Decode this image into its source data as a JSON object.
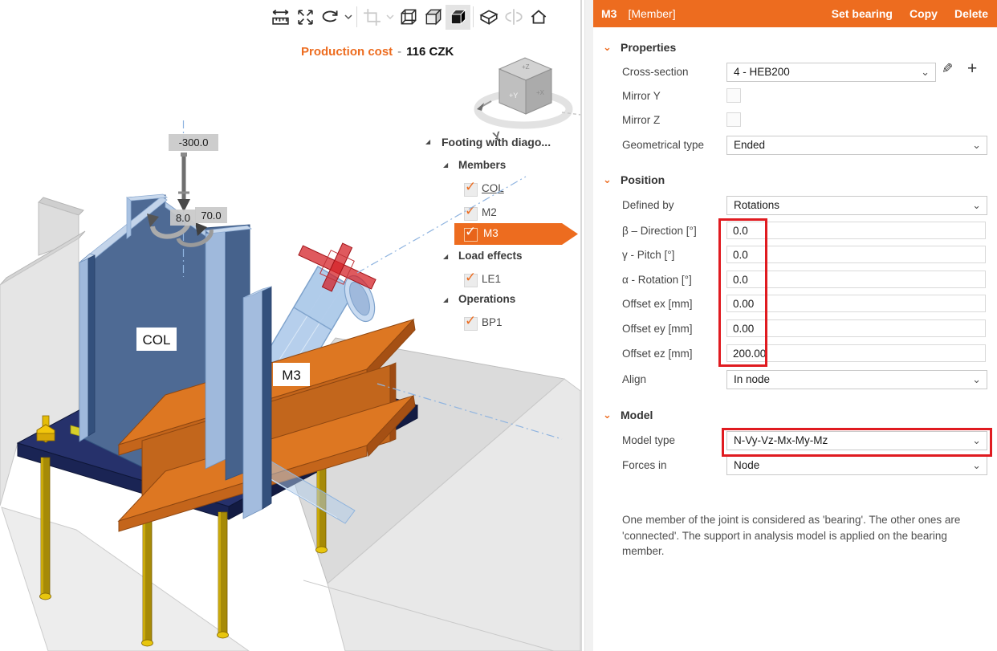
{
  "toolbar": {
    "icons": [
      {
        "name": "measure-icon",
        "state": "normal"
      },
      {
        "name": "fit-view-icon",
        "state": "normal"
      },
      {
        "name": "rotate-view-icon",
        "state": "normal"
      },
      {
        "name": "rotate-dropdown-chevron-icon",
        "state": "normal"
      },
      {
        "name": "section-cut-icon",
        "state": "disabled"
      },
      {
        "name": "section-dropdown-chevron-icon",
        "state": "disabled"
      },
      {
        "name": "wireframe-view-icon",
        "state": "normal"
      },
      {
        "name": "hidden-line-view-icon",
        "state": "normal"
      },
      {
        "name": "solid-view-icon",
        "state": "active"
      },
      {
        "name": "solid-edges-view-icon",
        "state": "normal"
      },
      {
        "name": "mirror-view-icon",
        "state": "disabled"
      },
      {
        "name": "home-view-icon",
        "state": "normal"
      }
    ]
  },
  "viewport": {
    "production_cost": {
      "label": "Production cost",
      "sep": "-",
      "value": "116 CZK"
    }
  },
  "scene": {
    "col_label": "COL",
    "m3_label": "M3",
    "force_label": "-300.0",
    "moment1_label": "8.0",
    "moment2_label": "70.0"
  },
  "tree": {
    "root": "Footing with diago...",
    "groups": [
      {
        "label": "Members",
        "items": [
          {
            "label": "COL",
            "checked": true
          },
          {
            "label": "M2",
            "checked": true
          },
          {
            "label": "M3",
            "checked": true,
            "selected": true
          }
        ]
      },
      {
        "label": "Load effects",
        "items": [
          {
            "label": "LE1",
            "checked": true
          }
        ]
      },
      {
        "label": "Operations",
        "items": [
          {
            "label": "BP1",
            "checked": true
          }
        ]
      }
    ]
  },
  "panel": {
    "header": {
      "title": "M3",
      "tag": "[Member]",
      "actions": [
        "Set bearing",
        "Copy",
        "Delete"
      ]
    },
    "properties": {
      "title": "Properties",
      "cross_section": {
        "label": "Cross-section",
        "value": "4 - HEB200"
      },
      "mirror_y": {
        "label": "Mirror Y",
        "checked": false
      },
      "mirror_z": {
        "label": "Mirror Z",
        "checked": false
      },
      "geometrical_type": {
        "label": "Geometrical type",
        "value": "Ended"
      }
    },
    "position": {
      "title": "Position",
      "defined_by": {
        "label": "Defined by",
        "value": "Rotations"
      },
      "fields": [
        {
          "label": "β – Direction [°]",
          "value": "0.0"
        },
        {
          "label": "γ - Pitch [°]",
          "value": "0.0"
        },
        {
          "label": "α - Rotation [°]",
          "value": "0.0"
        },
        {
          "label": "Offset ex [mm]",
          "value": "0.00"
        },
        {
          "label": "Offset ey [mm]",
          "value": "0.00"
        },
        {
          "label": "Offset ez [mm]",
          "value": "200.00"
        }
      ],
      "align": {
        "label": "Align",
        "value": "In node"
      }
    },
    "model": {
      "title": "Model",
      "model_type": {
        "label": "Model type",
        "value": "N-Vy-Vz-Mx-My-Mz"
      },
      "forces_in": {
        "label": "Forces in",
        "value": "Node"
      }
    },
    "note": "One member of the joint is considered as 'bearing'. The other ones are 'connected'. The support in analysis model is applied on the bearing member."
  },
  "icons": {
    "check": "✓",
    "chevron_down": "⌄",
    "expander": "◢",
    "pencil": "✎",
    "plus": "+"
  },
  "colors": {
    "accent": "#ed6c1f",
    "highlight_red": "#e01b20",
    "steel_blue": "#9fb9dc",
    "beam_orange": "#c2661c",
    "plate_navy": "#26316b"
  }
}
